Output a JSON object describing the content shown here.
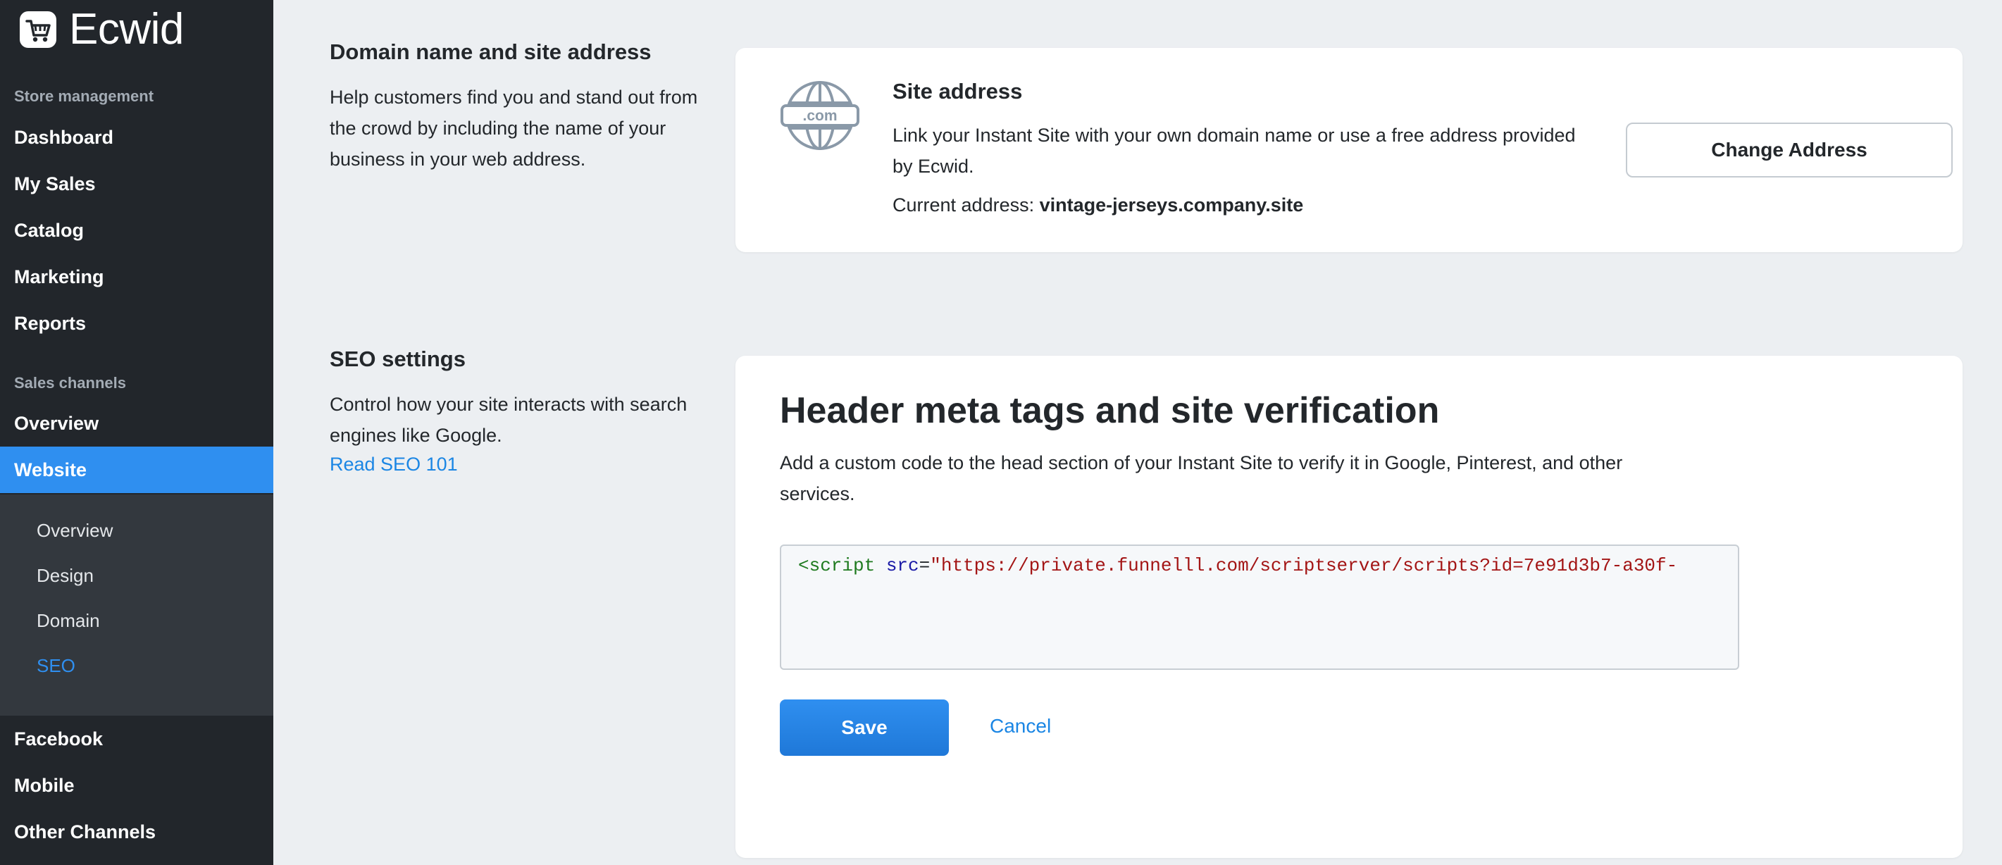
{
  "sidebar": {
    "logo_text": "Ecwid",
    "store_section_label": "Store management",
    "store_items": [
      {
        "label": "Dashboard"
      },
      {
        "label": "My Sales"
      },
      {
        "label": "Catalog"
      },
      {
        "label": "Marketing"
      },
      {
        "label": "Reports"
      }
    ],
    "sales_section_label": "Sales channels",
    "sales_items": [
      {
        "label": "Overview"
      },
      {
        "label": "Website"
      }
    ],
    "website_subitems": [
      {
        "label": "Overview"
      },
      {
        "label": "Design"
      },
      {
        "label": "Domain"
      },
      {
        "label": "SEO"
      }
    ],
    "bottom_items": [
      {
        "label": "Facebook"
      },
      {
        "label": "Mobile"
      },
      {
        "label": "Other Channels"
      }
    ],
    "active_item": "Website",
    "active_subitem": "SEO",
    "accent_color": "#2f8ff0"
  },
  "domain_section": {
    "title": "Domain name and site address",
    "description": "Help customers find you and stand out from the crowd by including the name of your business in your web address.",
    "card": {
      "icon": "globe-icon",
      "icon_label": ".com",
      "title": "Site address",
      "description": "Link your Instant Site with your own domain name or use a free address provided by Ecwid.",
      "current_label": "Current address:",
      "current_value": "vintage-jerseys.company.site",
      "button_label": "Change Address"
    }
  },
  "seo_section": {
    "title": "SEO settings",
    "description": "Control how your site interacts with search engines like Google.",
    "link": "Read SEO 101",
    "card": {
      "title": "Header meta tags and site verification",
      "description": "Add a custom code to the head section of your Instant Site to verify it in Google, Pinterest, and other services.",
      "code": {
        "tag": "<script",
        "attr": "src",
        "eq": "=",
        "value": "\"https://private.funnelll.com/scriptserver/scripts?id=7e91d3b7-a30f-"
      },
      "save_label": "Save",
      "cancel_label": "Cancel"
    }
  }
}
